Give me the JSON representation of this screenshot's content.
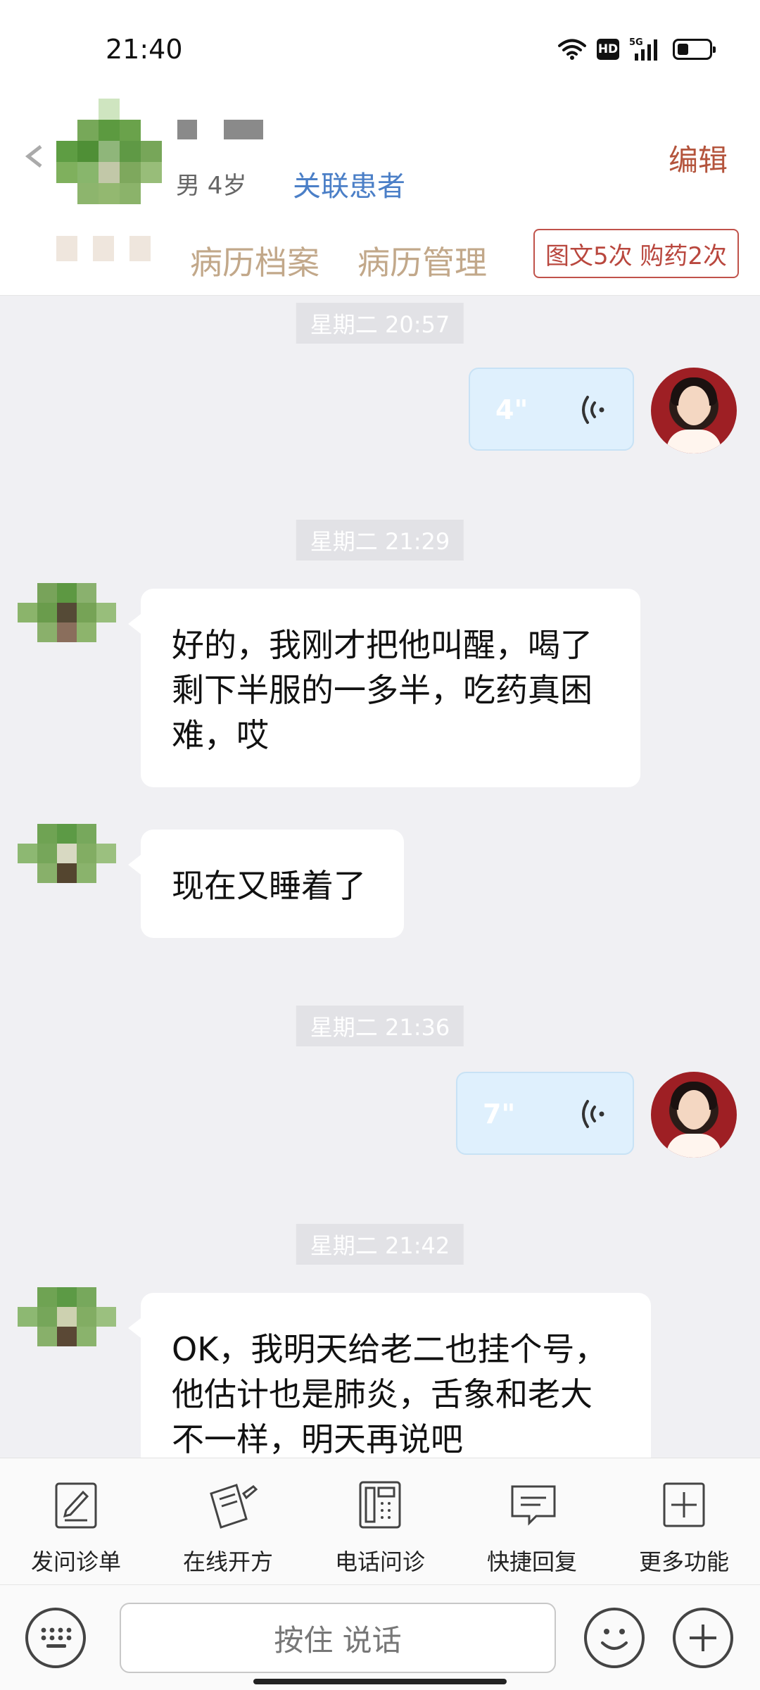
{
  "status_bar": {
    "time": "21:40",
    "hd": "HD",
    "network": "5G",
    "battery_level": 0.35
  },
  "header": {
    "gender_age": "男 4岁",
    "link_patient": "关联患者",
    "edit": "编辑",
    "tabs": [
      "病历档案",
      "病历管理"
    ],
    "service_badge": "图文5次 购药2次"
  },
  "chat": {
    "messages": [
      {
        "type": "timestamp",
        "text": "星期二 20:57"
      },
      {
        "type": "voice",
        "sender": "doctor",
        "duration": "4\""
      },
      {
        "type": "timestamp",
        "text": "星期二 21:29"
      },
      {
        "type": "text",
        "sender": "patient",
        "lines": [
          "好的，我刚才把他叫醒，喝了",
          "剩下半服的一多半，吃药真困",
          "难，哎"
        ]
      },
      {
        "type": "text",
        "sender": "patient",
        "lines": [
          "现在又睡着了"
        ]
      },
      {
        "type": "timestamp",
        "text": "星期二 21:36"
      },
      {
        "type": "voice",
        "sender": "doctor",
        "duration": "7\""
      },
      {
        "type": "timestamp",
        "text": "星期二 21:42"
      },
      {
        "type": "text",
        "sender": "patient",
        "lines": [
          "OK，我明天给老二也挂个号，",
          "他估计也是肺炎，舌象和老大",
          "不一样，明天再说吧"
        ]
      }
    ]
  },
  "toolbar": [
    {
      "label": "发问诊单",
      "icon": "questionnaire-icon"
    },
    {
      "label": "在线开方",
      "icon": "prescription-icon"
    },
    {
      "label": "电话问诊",
      "icon": "phone-icon"
    },
    {
      "label": "快捷回复",
      "icon": "quick-reply-icon"
    },
    {
      "label": "更多功能",
      "icon": "more-icon"
    }
  ],
  "input_bar": {
    "hold_to_talk": "按住 说话"
  },
  "colors": {
    "accent_red": "#b9473e",
    "link_blue": "#4b7fc7",
    "tab_gold": "#c2a88a",
    "voice_bubble": "#dff0fd"
  }
}
